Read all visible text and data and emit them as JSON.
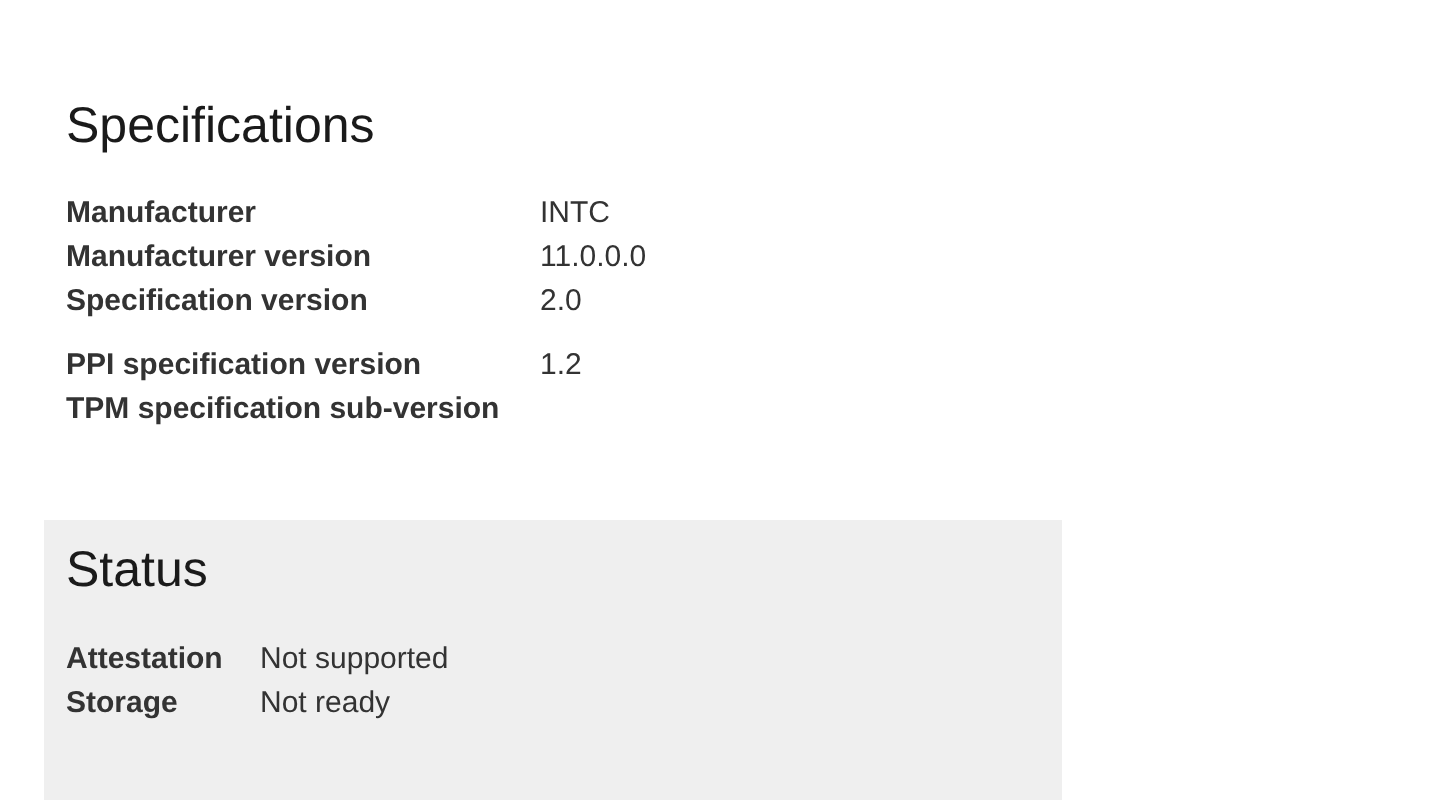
{
  "specifications": {
    "title": "Specifications",
    "groups": [
      {
        "rows": [
          {
            "label": "Manufacturer",
            "value": "INTC"
          },
          {
            "label": "Manufacturer version",
            "value": "11.0.0.0"
          },
          {
            "label": "Specification version",
            "value": "2.0"
          }
        ]
      },
      {
        "rows": [
          {
            "label": "PPI specification version",
            "value": "1.2"
          },
          {
            "label": "TPM specification sub-version"
          }
        ]
      }
    ]
  },
  "status": {
    "title": "Status",
    "rows": [
      {
        "label": "Attestation",
        "value": "Not supported"
      },
      {
        "label": "Storage",
        "value": "Not ready"
      }
    ]
  }
}
